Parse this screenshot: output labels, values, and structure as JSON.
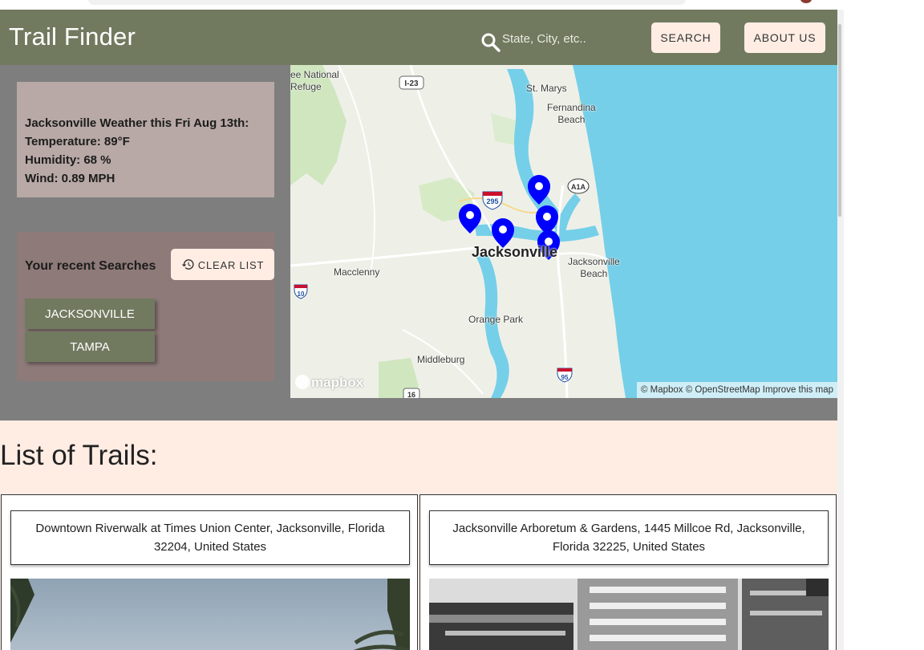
{
  "app": {
    "title": "Trail Finder",
    "search": {
      "placeholder": "State, City, etc..",
      "value": ""
    },
    "search_button": "SEARCH",
    "about_button": "ABOUT US"
  },
  "weather": {
    "heading": "Jacksonville Weather this Fri Aug 13th:",
    "temperature": "Temperature: 89°F",
    "humidity": "Humidity: 68 %",
    "wind": "Wind: 0.89 MPH"
  },
  "recent": {
    "title": "Your recent Searches",
    "clear_label": "CLEAR LIST",
    "items": [
      "JACKSONVILLE",
      "TAMPA"
    ]
  },
  "map": {
    "labels": {
      "refuge": "ee National\nRefuge",
      "st_marys": "St. Marys",
      "fernandina": "Fernandina\nBeach",
      "jacksonville": "Jacksonville",
      "jax_beach": "Jacksonville\nBeach",
      "macclenny": "Macclenny",
      "orange_park": "Orange Park",
      "middleburg": "Middleburg"
    },
    "shields": [
      "I-23",
      "295",
      "A1A",
      "10",
      "95",
      "16"
    ],
    "logo": "mapbox",
    "attribution": "© Mapbox © OpenStreetMap Improve this map",
    "marker_color": "#0000ff",
    "water_color": "#75cfe9"
  },
  "list": {
    "heading": "List of Trails:",
    "trails": [
      {
        "address": "Downtown Riverwalk at Times Union Center, Jacksonville, Florida 32204, United States"
      },
      {
        "address": "Jacksonville Arboretum & Gardens, 1445 Millcoe Rd, Jacksonville, Florida 32225, United States"
      }
    ]
  },
  "colors": {
    "header": "#717a5f",
    "accent_light": "#ffede4",
    "panel_gray": "#7e7e7e",
    "weather_card": "#b8a9a6",
    "recent_card": "#8e7a79"
  }
}
